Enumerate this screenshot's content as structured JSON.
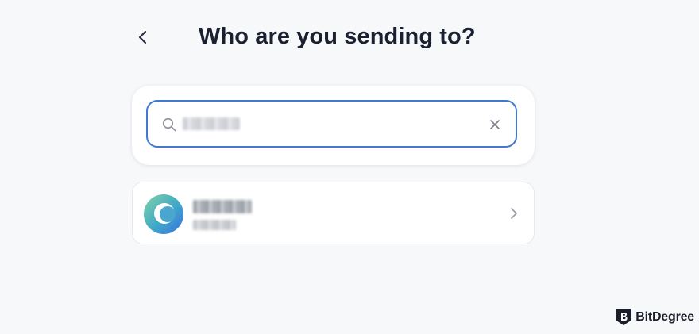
{
  "header": {
    "title": "Who are you sending to?"
  },
  "search": {
    "value": "",
    "value_redacted": true
  },
  "contacts": [
    {
      "name_redacted": true,
      "handle_redacted": true
    }
  ],
  "brand": {
    "name": "BitDegree"
  },
  "colors": {
    "background": "#f7f8fa",
    "focus_border": "#3f7ad1",
    "title_text": "#1a2030"
  },
  "icons": {
    "back": "chevron-left-icon",
    "search": "search-icon",
    "clear": "close-icon",
    "contact_arrow": "chevron-right-icon",
    "brand_logo": "bitdegree-logo-icon"
  }
}
